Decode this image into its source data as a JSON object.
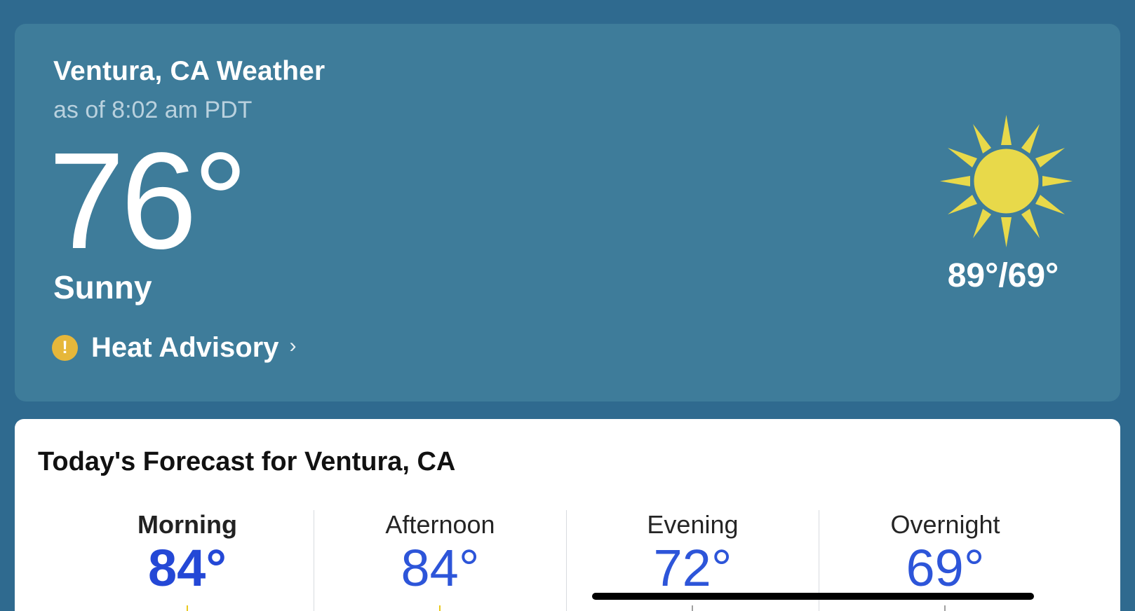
{
  "current": {
    "title": "Ventura, CA Weather",
    "timestamp": "as of 8:02 am PDT",
    "temperature": "76°",
    "condition": "Sunny",
    "hi_lo": "89°/69°",
    "alert": {
      "label": "Heat Advisory",
      "icon": "exclamation-icon",
      "color": "#e6b73a"
    },
    "weather_icon": "sun-icon",
    "sun_color": "#e8d94a"
  },
  "forecast": {
    "title": "Today's Forecast for Ventura, CA",
    "periods": [
      {
        "label": "Morning",
        "temp": "84°",
        "active": true
      },
      {
        "label": "Afternoon",
        "temp": "84°",
        "active": false
      },
      {
        "label": "Evening",
        "temp": "72°",
        "active": false
      },
      {
        "label": "Overnight",
        "temp": "69°",
        "active": false
      }
    ],
    "temp_color": "#2d55d9"
  },
  "colors": {
    "page_background": "#2f6a8f",
    "current_card": "#3e7c9a",
    "forecast_card": "#ffffff"
  }
}
